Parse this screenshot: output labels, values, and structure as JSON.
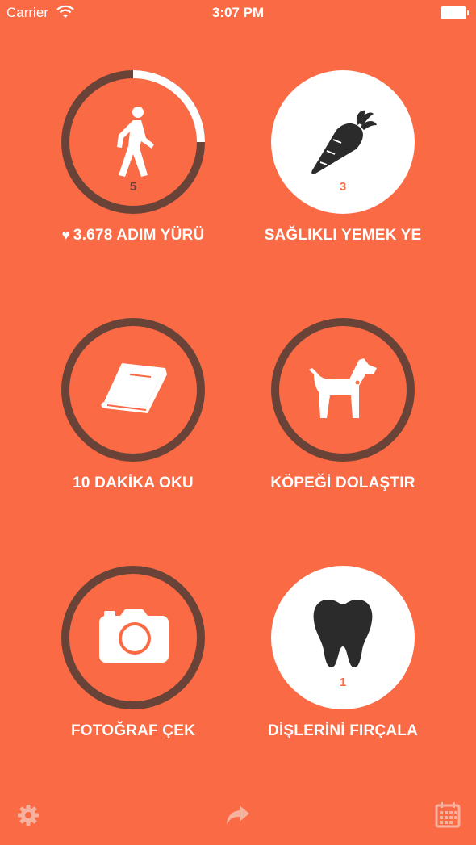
{
  "status_bar": {
    "carrier": "Carrier",
    "time": "3:07 PM"
  },
  "colors": {
    "background": "#fa6a45",
    "ring_dark": "#6a4338",
    "ring_light": "#ffffff",
    "icon_dark": "#2b2b2b"
  },
  "habits": [
    {
      "label": "3.678 ADIM YÜRÜ",
      "count": "5",
      "icon": "walking-person-icon",
      "progress": 0.25,
      "has_heart": true,
      "completed": false
    },
    {
      "label": "SAĞLIKLI YEMEK YE",
      "count": "3",
      "icon": "carrot-icon",
      "progress": 1.0,
      "has_heart": false,
      "completed": true
    },
    {
      "label": "10 DAKİKA OKU",
      "count": "",
      "icon": "book-icon",
      "progress": 0,
      "has_heart": false,
      "completed": false
    },
    {
      "label": "KÖPEĞİ DOLAŞTIR",
      "count": "",
      "icon": "dog-icon",
      "progress": 0,
      "has_heart": false,
      "completed": false
    },
    {
      "label": "FOTOĞRAF ÇEK",
      "count": "",
      "icon": "camera-icon",
      "progress": 0,
      "has_heart": false,
      "completed": false
    },
    {
      "label": "DİŞLERİNİ FIRÇALA",
      "count": "1",
      "icon": "tooth-icon",
      "progress": 1.0,
      "has_heart": false,
      "completed": true
    }
  ],
  "toolbar": {
    "items": [
      "gear-icon",
      "share-icon",
      "calendar-icon"
    ]
  }
}
